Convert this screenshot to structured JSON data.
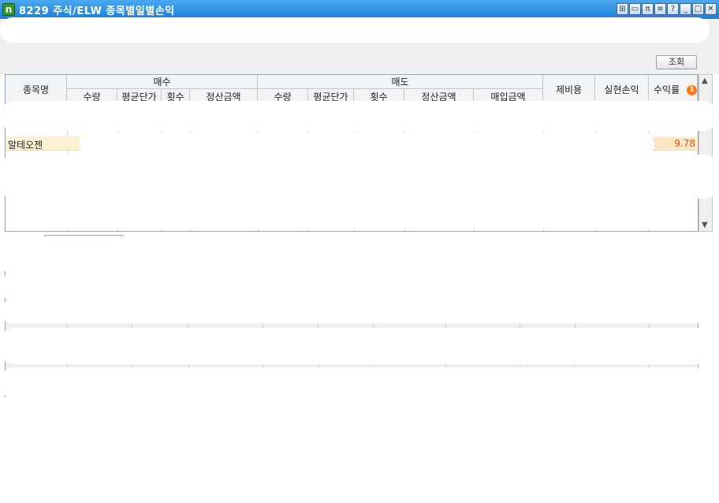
{
  "window": {
    "icon_glyph": "n",
    "title": "8229 주식/ELW 종목별일별손익",
    "buttons": [
      "⊞",
      "▭",
      "π",
      "≡",
      "?",
      "_",
      "□",
      "✕"
    ]
  },
  "condition": {
    "inquiry_label": "조회"
  },
  "grid": {
    "headers": {
      "name": "종목명",
      "buy_group": "매수",
      "sell_group": "매도",
      "buy_cols": [
        "수량",
        "평균단가",
        "횟수",
        "정산금액"
      ],
      "sell_cols": [
        "수량",
        "평균단가",
        "횟수",
        "정산금액",
        "매입금액"
      ],
      "fee": "제비용",
      "realized": "실현손익",
      "rate": "수익률"
    },
    "badge": "1",
    "rows": [
      {
        "name": "알테오젠",
        "rate": "9.78"
      }
    ]
  },
  "icons": {
    "scroll_up": "scroll-up-icon",
    "scroll_down": "scroll-down-icon",
    "app": "app-logo-icon"
  },
  "colors": {
    "title_bar": "#1a7fd6",
    "highlight_row": "#fdf1d2",
    "rate_text": "#e05a00",
    "badge": "#ff7a1a"
  }
}
